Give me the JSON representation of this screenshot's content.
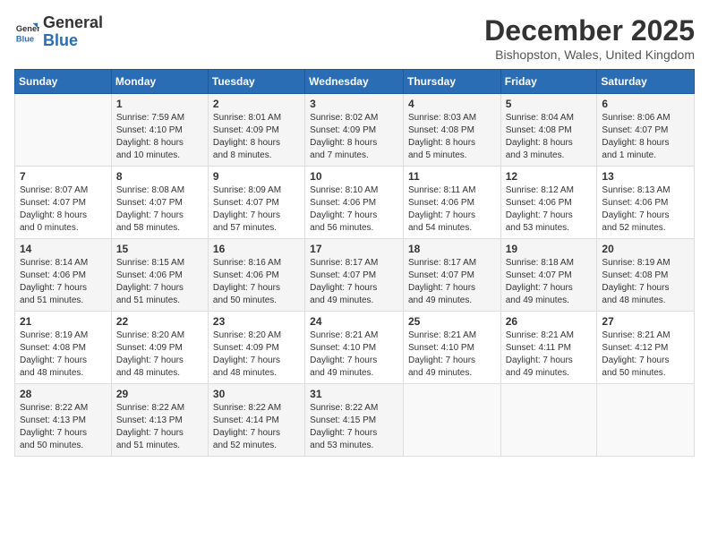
{
  "header": {
    "logo_general": "General",
    "logo_blue": "Blue",
    "month_year": "December 2025",
    "location": "Bishopston, Wales, United Kingdom"
  },
  "weekdays": [
    "Sunday",
    "Monday",
    "Tuesday",
    "Wednesday",
    "Thursday",
    "Friday",
    "Saturday"
  ],
  "weeks": [
    [
      {
        "day": "",
        "info": ""
      },
      {
        "day": "1",
        "info": "Sunrise: 7:59 AM\nSunset: 4:10 PM\nDaylight: 8 hours\nand 10 minutes."
      },
      {
        "day": "2",
        "info": "Sunrise: 8:01 AM\nSunset: 4:09 PM\nDaylight: 8 hours\nand 8 minutes."
      },
      {
        "day": "3",
        "info": "Sunrise: 8:02 AM\nSunset: 4:09 PM\nDaylight: 8 hours\nand 7 minutes."
      },
      {
        "day": "4",
        "info": "Sunrise: 8:03 AM\nSunset: 4:08 PM\nDaylight: 8 hours\nand 5 minutes."
      },
      {
        "day": "5",
        "info": "Sunrise: 8:04 AM\nSunset: 4:08 PM\nDaylight: 8 hours\nand 3 minutes."
      },
      {
        "day": "6",
        "info": "Sunrise: 8:06 AM\nSunset: 4:07 PM\nDaylight: 8 hours\nand 1 minute."
      }
    ],
    [
      {
        "day": "7",
        "info": "Sunrise: 8:07 AM\nSunset: 4:07 PM\nDaylight: 8 hours\nand 0 minutes."
      },
      {
        "day": "8",
        "info": "Sunrise: 8:08 AM\nSunset: 4:07 PM\nDaylight: 7 hours\nand 58 minutes."
      },
      {
        "day": "9",
        "info": "Sunrise: 8:09 AM\nSunset: 4:07 PM\nDaylight: 7 hours\nand 57 minutes."
      },
      {
        "day": "10",
        "info": "Sunrise: 8:10 AM\nSunset: 4:06 PM\nDaylight: 7 hours\nand 56 minutes."
      },
      {
        "day": "11",
        "info": "Sunrise: 8:11 AM\nSunset: 4:06 PM\nDaylight: 7 hours\nand 54 minutes."
      },
      {
        "day": "12",
        "info": "Sunrise: 8:12 AM\nSunset: 4:06 PM\nDaylight: 7 hours\nand 53 minutes."
      },
      {
        "day": "13",
        "info": "Sunrise: 8:13 AM\nSunset: 4:06 PM\nDaylight: 7 hours\nand 52 minutes."
      }
    ],
    [
      {
        "day": "14",
        "info": "Sunrise: 8:14 AM\nSunset: 4:06 PM\nDaylight: 7 hours\nand 51 minutes."
      },
      {
        "day": "15",
        "info": "Sunrise: 8:15 AM\nSunset: 4:06 PM\nDaylight: 7 hours\nand 51 minutes."
      },
      {
        "day": "16",
        "info": "Sunrise: 8:16 AM\nSunset: 4:06 PM\nDaylight: 7 hours\nand 50 minutes."
      },
      {
        "day": "17",
        "info": "Sunrise: 8:17 AM\nSunset: 4:07 PM\nDaylight: 7 hours\nand 49 minutes."
      },
      {
        "day": "18",
        "info": "Sunrise: 8:17 AM\nSunset: 4:07 PM\nDaylight: 7 hours\nand 49 minutes."
      },
      {
        "day": "19",
        "info": "Sunrise: 8:18 AM\nSunset: 4:07 PM\nDaylight: 7 hours\nand 49 minutes."
      },
      {
        "day": "20",
        "info": "Sunrise: 8:19 AM\nSunset: 4:08 PM\nDaylight: 7 hours\nand 48 minutes."
      }
    ],
    [
      {
        "day": "21",
        "info": "Sunrise: 8:19 AM\nSunset: 4:08 PM\nDaylight: 7 hours\nand 48 minutes."
      },
      {
        "day": "22",
        "info": "Sunrise: 8:20 AM\nSunset: 4:09 PM\nDaylight: 7 hours\nand 48 minutes."
      },
      {
        "day": "23",
        "info": "Sunrise: 8:20 AM\nSunset: 4:09 PM\nDaylight: 7 hours\nand 48 minutes."
      },
      {
        "day": "24",
        "info": "Sunrise: 8:21 AM\nSunset: 4:10 PM\nDaylight: 7 hours\nand 49 minutes."
      },
      {
        "day": "25",
        "info": "Sunrise: 8:21 AM\nSunset: 4:10 PM\nDaylight: 7 hours\nand 49 minutes."
      },
      {
        "day": "26",
        "info": "Sunrise: 8:21 AM\nSunset: 4:11 PM\nDaylight: 7 hours\nand 49 minutes."
      },
      {
        "day": "27",
        "info": "Sunrise: 8:21 AM\nSunset: 4:12 PM\nDaylight: 7 hours\nand 50 minutes."
      }
    ],
    [
      {
        "day": "28",
        "info": "Sunrise: 8:22 AM\nSunset: 4:13 PM\nDaylight: 7 hours\nand 50 minutes."
      },
      {
        "day": "29",
        "info": "Sunrise: 8:22 AM\nSunset: 4:13 PM\nDaylight: 7 hours\nand 51 minutes."
      },
      {
        "day": "30",
        "info": "Sunrise: 8:22 AM\nSunset: 4:14 PM\nDaylight: 7 hours\nand 52 minutes."
      },
      {
        "day": "31",
        "info": "Sunrise: 8:22 AM\nSunset: 4:15 PM\nDaylight: 7 hours\nand 53 minutes."
      },
      {
        "day": "",
        "info": ""
      },
      {
        "day": "",
        "info": ""
      },
      {
        "day": "",
        "info": ""
      }
    ]
  ]
}
